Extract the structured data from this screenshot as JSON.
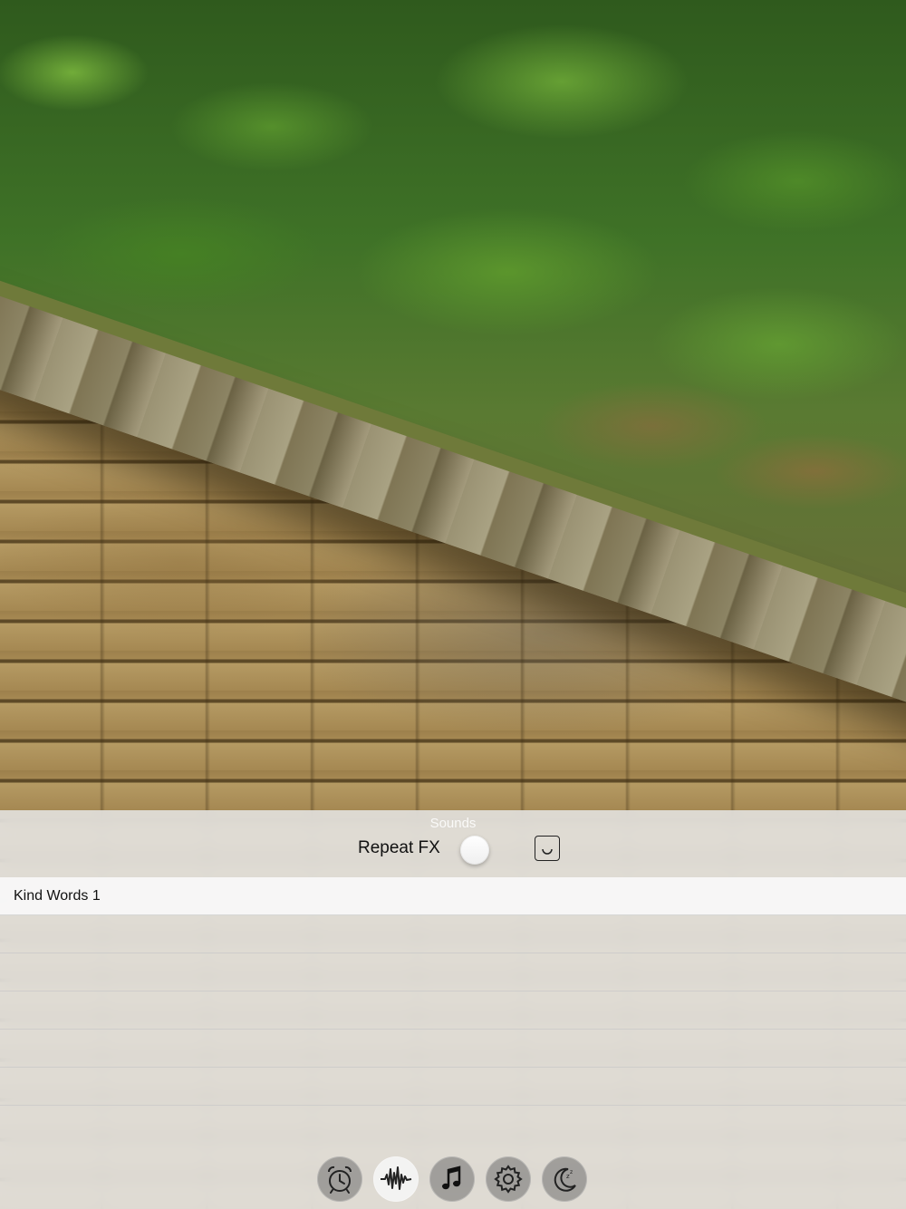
{
  "panel": {
    "title": "Sounds",
    "repeat_label": "Repeat FX",
    "repeat_enabled": false
  },
  "sounds": {
    "items": [
      {
        "label": "Kind Words 1",
        "selected": true
      },
      {
        "label": ""
      },
      {
        "label": ""
      },
      {
        "label": ""
      },
      {
        "label": ""
      },
      {
        "label": ""
      }
    ]
  },
  "tabs": [
    {
      "icon": "alarm-clock-icon",
      "selected": false
    },
    {
      "icon": "waveform-icon",
      "selected": true
    },
    {
      "icon": "music-note-icon",
      "selected": false
    },
    {
      "icon": "gear-icon",
      "selected": false
    },
    {
      "icon": "moon-sleep-icon",
      "selected": false
    }
  ],
  "colors": {
    "panel_bg": "#e8e8e8",
    "tab_bg": "#6e6e6e",
    "tab_selected_bg": "#f5f5f5"
  }
}
